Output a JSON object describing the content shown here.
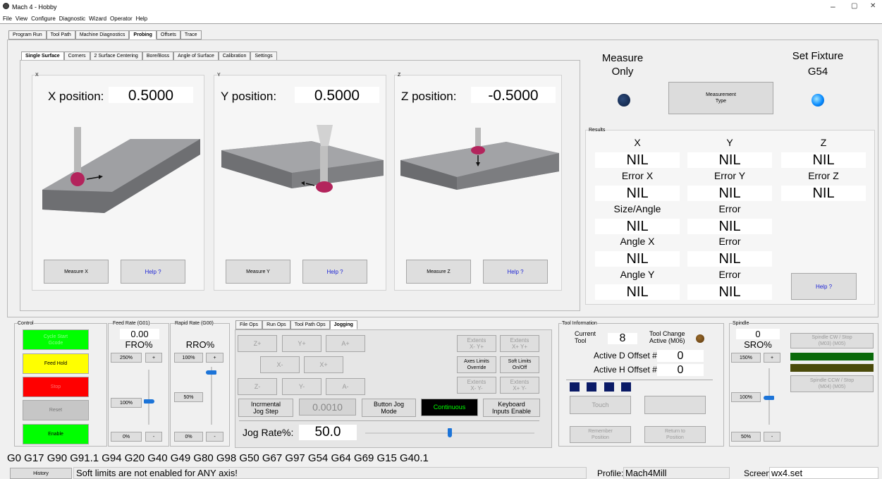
{
  "window": {
    "title": "Mach 4 - Hobby",
    "minimize": "–",
    "restore": "▢",
    "close": "✕"
  },
  "menu": [
    "File",
    "View",
    "Configure",
    "Diagnostic",
    "Wizard",
    "Operator",
    "Help"
  ],
  "main_tabs": [
    "Program Run",
    "Tool Path",
    "Machine Diagnostics",
    "Probing",
    "Offsets",
    "Trace"
  ],
  "probe_tabs": [
    "Single Surface",
    "Corners",
    "2 Surface Centering",
    "Bore/Boss",
    "Angle of Surface",
    "Calibration",
    "Settings"
  ],
  "axes": {
    "x": {
      "group": "X",
      "label": "X position:",
      "value": "0.5000",
      "measure": "Measure\nX",
      "help": "Help ?"
    },
    "y": {
      "group": "Y",
      "label": "Y position:",
      "value": "0.5000",
      "measure": "Measure\nY",
      "help": "Help ?"
    },
    "z": {
      "group": "Z",
      "label": "Z position:",
      "value": "-0.5000",
      "measure": "Measure\nZ",
      "help": "Help ?"
    }
  },
  "measure_only": "Measure\nOnly",
  "measurement_type": "Measurement\nType",
  "set_fixture": "Set Fixture",
  "fixture": "G54",
  "results": {
    "label": "Results",
    "x": "X",
    "y": "Y",
    "z": "Z",
    "nil": "NIL",
    "error_x": "Error X",
    "error_y": "Error Y",
    "error_z": "Error Z",
    "size_angle": "Size/Angle",
    "error": "Error",
    "angle_x": "Angle X",
    "angle_y": "Angle Y",
    "help": "Help ?"
  },
  "control": {
    "label": "Control",
    "cycle_start": "Cycle Start\nGcode",
    "feed_hold": "Feed Hold",
    "stop": "Stop",
    "reset": "Reset",
    "enable": "Enable"
  },
  "feed": {
    "label": "Feed Rate (G01)",
    "value": "0.00",
    "fro": "FRO%",
    "b250": "250%",
    "plus": "+",
    "b100": "100%",
    "b0": "0%",
    "minus": "-",
    "level": "100%"
  },
  "rapid": {
    "label": "Rapid Rate (G00)",
    "rro": "RRO%",
    "b100": "100%",
    "plus": "+",
    "b50": "50%",
    "b0": "0%",
    "minus": "-",
    "level": "100%"
  },
  "jog_tabs": [
    "File Ops",
    "Run Ops",
    "Tool Path Ops",
    "Jogging"
  ],
  "jog": {
    "zp": "Z+",
    "yp": "Y+",
    "ap": "A+",
    "xm": "X-",
    "xp": "X+",
    "zm": "Z-",
    "ym": "Y-",
    "am": "A-",
    "ext_xmyp": "Extents\nX- Y+",
    "ext_xpyp": "Extents\nX+ Y+",
    "axes_limits": "Axes Limits\nOverride",
    "soft_limits": "Soft Limits\nOn/Off",
    "ext_xmym": "Extents\nX- Y-",
    "ext_xpym": "Extents\nX+ Y-",
    "incremental": "Incrmental\nJog Step",
    "increment": "0.0010",
    "button_jog": "Button Jog\nMode",
    "continuous": "Continuous",
    "keyboard": "Keyboard\nInputs Enable",
    "rate_label": "Jog Rate%:",
    "rate": "50.0",
    "rate_fraction": 0.5
  },
  "tool": {
    "label": "Tool Information",
    "current": "Current\nTool",
    "tool_num": "8",
    "tool_change": "Tool Change\nActive (M06)",
    "d_offset": "Active D Offset #:",
    "d_val": "0",
    "h_offset": "Active H Offset #:",
    "h_val": "0",
    "touch": "Touch",
    "remember": "Remember\nPosition",
    "return": "Return to\nPosition"
  },
  "spindle": {
    "label": "Spindle",
    "value": "0",
    "sro": "SRO%",
    "b150": "150%",
    "plus": "+",
    "b100": "100%",
    "b50": "50%",
    "minus": "-",
    "cw": "Spindle CW / Stop\n(M03)        (M05)",
    "ccw": "Spindle CCW / Stop\n(M04)        (M05)",
    "level": "100%"
  },
  "gcode": "G0 G17 G90 G91.1 G94 G20 G40 G49 G80 G98 G50 G67 G97 G54 G64 G69 G15 G40.1",
  "status": {
    "history": "History",
    "message": "Soft limits are not enabled for ANY axis!",
    "profile_label": "Profile:",
    "profile": "Mach4Mill",
    "screen_label": "Screen",
    "screen": "wx4.set"
  },
  "colors": {
    "cycle_start": "#00ff00",
    "feed_hold": "#ffff00",
    "stop": "#ff0000",
    "enable": "#00ff00",
    "continuous": "#00ff00"
  }
}
